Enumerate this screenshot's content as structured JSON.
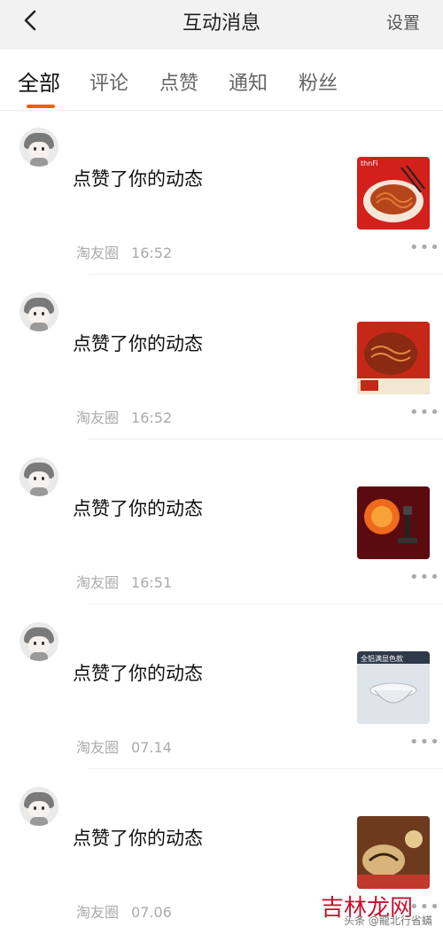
{
  "header": {
    "title": "互动消息",
    "settings_label": "设置"
  },
  "tabs": [
    {
      "label": "全部",
      "active": true
    },
    {
      "label": "评论",
      "active": false
    },
    {
      "label": "点赞",
      "active": false
    },
    {
      "label": "通知",
      "active": false
    },
    {
      "label": "粉丝",
      "active": false
    }
  ],
  "colors": {
    "accent": "#ff5a00"
  },
  "items": [
    {
      "action": "点赞了你的动态",
      "source": "淘友圈",
      "time": "16:52",
      "thumb": {
        "icon": "noodles-thumbnail",
        "label": "thnFi",
        "bg": "#d3201b"
      }
    },
    {
      "action": "点赞了你的动态",
      "source": "淘友圈",
      "time": "16:52",
      "thumb": {
        "icon": "noodles-thumbnail",
        "label": "",
        "bg": "#c62818"
      }
    },
    {
      "action": "点赞了你的动态",
      "source": "淘友圈",
      "time": "16:51",
      "thumb": {
        "icon": "sunset-lamp-thumbnail",
        "label": "",
        "bg": "#5a0b10"
      }
    },
    {
      "action": "点赞了你的动态",
      "source": "淘友圈",
      "time": "07.14",
      "thumb": {
        "icon": "downlight-thumbnail",
        "label": "全铝满显色款",
        "bg": "#dfe4ea"
      }
    },
    {
      "action": "点赞了你的动态",
      "source": "淘友圈",
      "time": "07.06",
      "thumb": {
        "icon": "pastry-thumbnail",
        "label": "",
        "bg": "#6e3a1e"
      }
    }
  ],
  "watermark": {
    "brand": "吉林龙网",
    "credit": "头条 @龍北行省蟎"
  }
}
